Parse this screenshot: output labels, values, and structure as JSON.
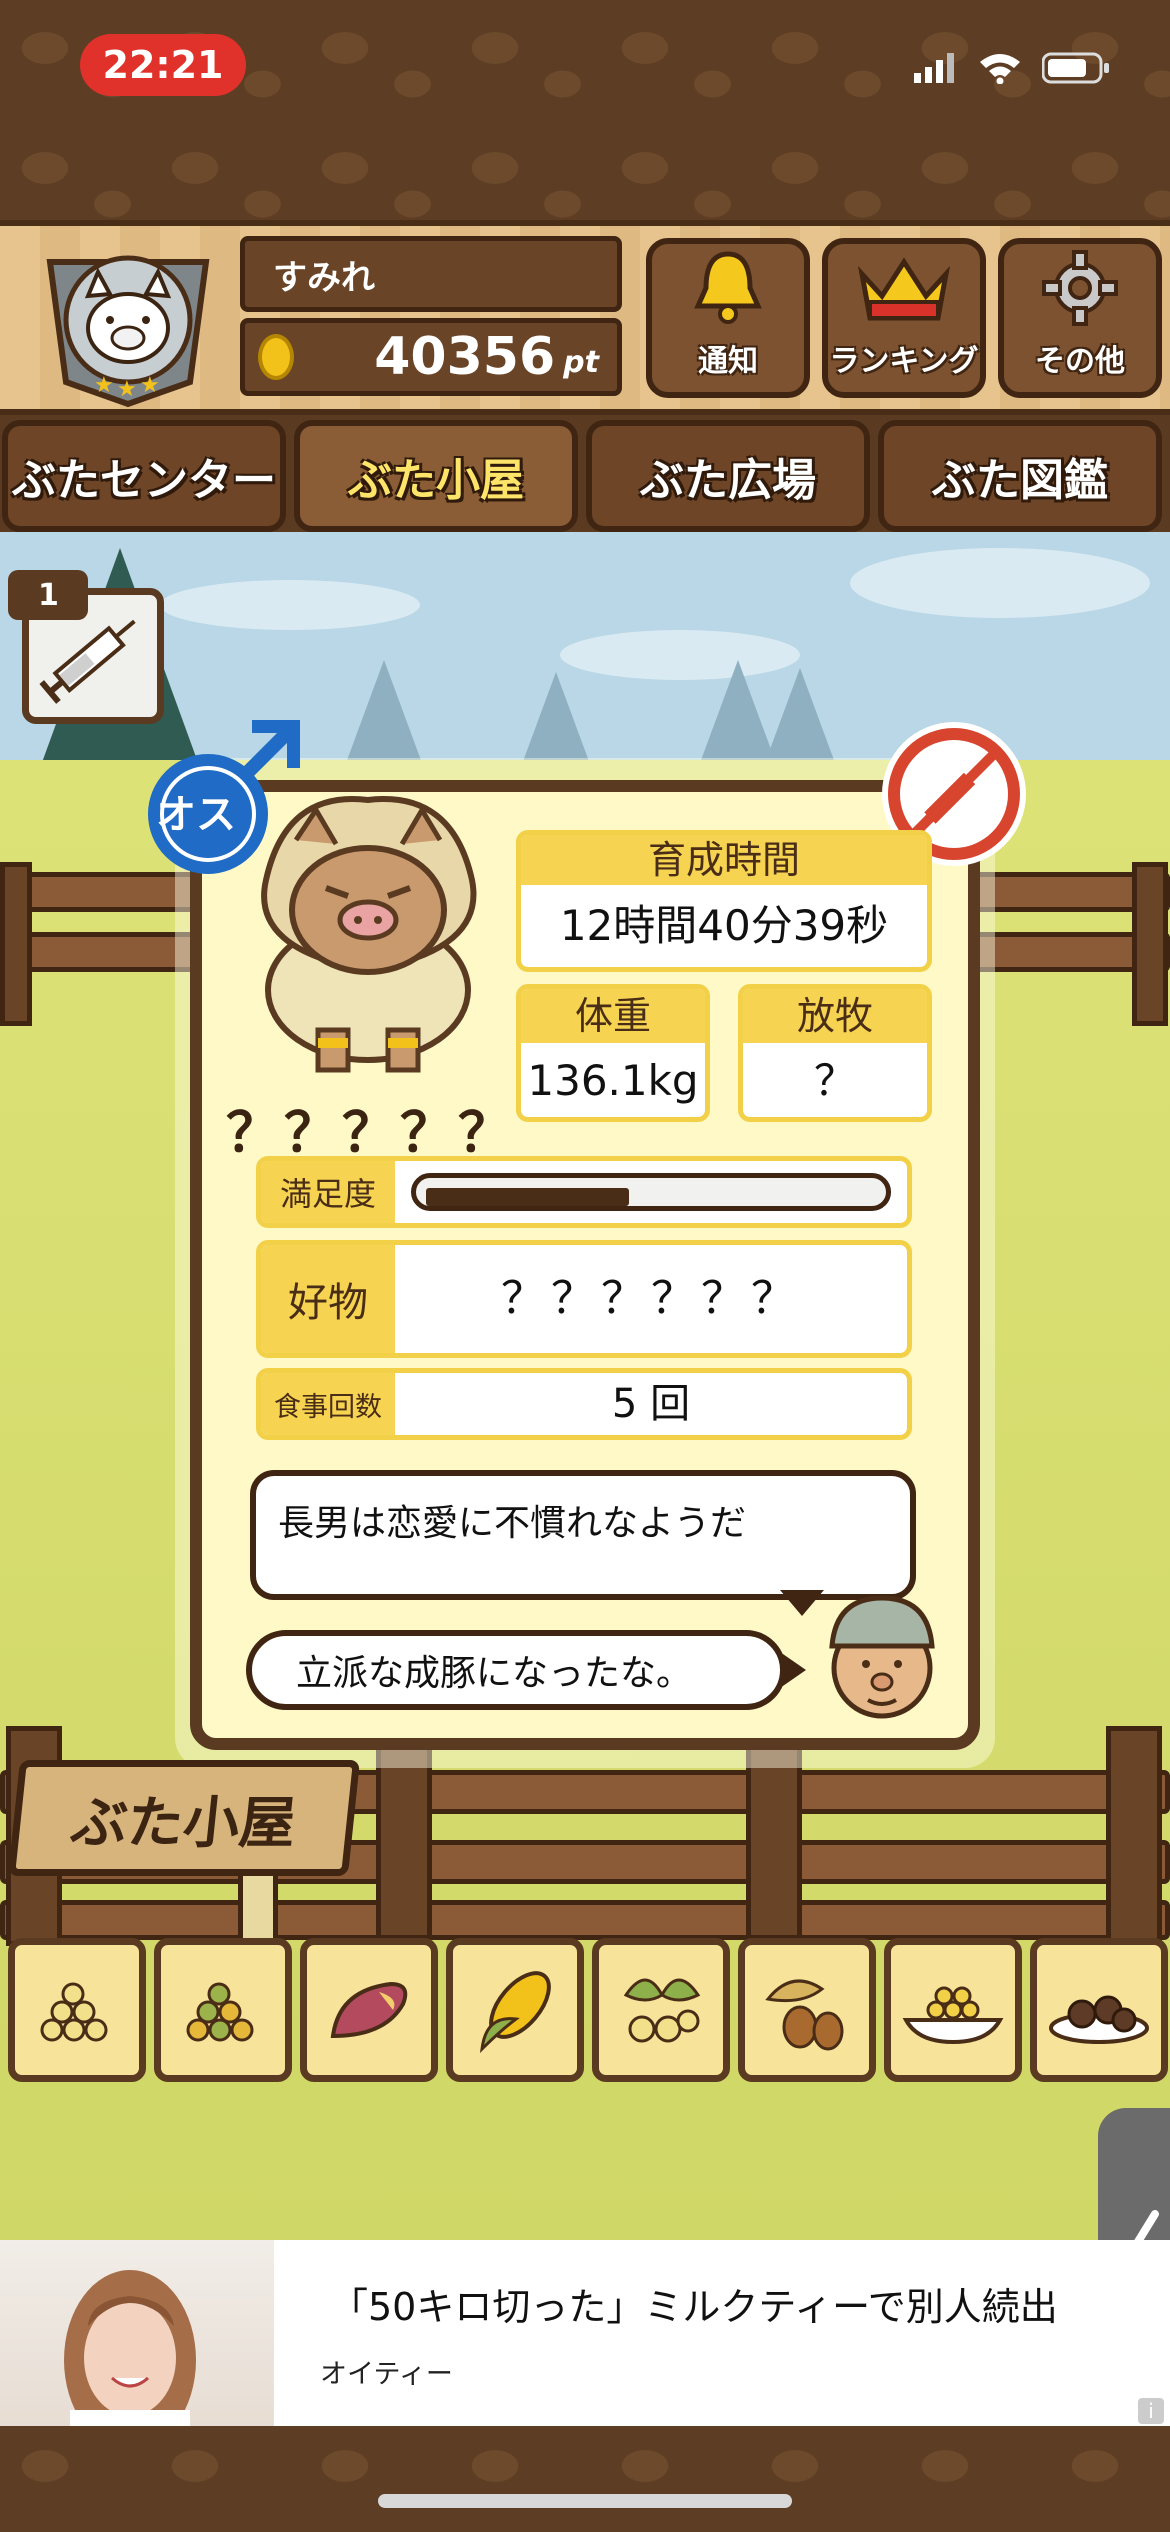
{
  "status_bar": {
    "time": "22:21"
  },
  "header": {
    "player_name": "すみれ",
    "points": "40356",
    "points_unit": "pt",
    "buttons": [
      {
        "label": "通知",
        "icon": "bell-icon"
      },
      {
        "label": "ランキング",
        "icon": "crown-icon"
      },
      {
        "label": "その他",
        "icon": "gear-icon"
      }
    ]
  },
  "tabs": [
    {
      "label": "ぶたセンター",
      "active": false
    },
    {
      "label": "ぶた小屋",
      "active": true
    },
    {
      "label": "ぶた広場",
      "active": false
    },
    {
      "label": "ぶた図鑑",
      "active": false
    }
  ],
  "item": {
    "count": "1",
    "icon": "syringe-icon"
  },
  "pig": {
    "gender": "オス",
    "name": "？？？？？",
    "raising_time_label": "育成時間",
    "raising_time_value": "12時間40分39秒",
    "weight_label": "体重",
    "weight_value": "136.1kg",
    "grazing_label": "放牧",
    "grazing_value": "？",
    "satisfaction_label": "満足度",
    "satisfaction_level": 0.45,
    "favorite_label": "好物",
    "favorite_value": "？？？？？？",
    "meals_label": "食事回数",
    "meals_value": "5 回"
  },
  "dialogue": {
    "message_1": "長男は恋愛に不慣れなようだ",
    "message_2": "立派な成豚になったな。"
  },
  "sign": {
    "label": "ぶた小屋"
  },
  "foods": [
    "soybeans-icon",
    "mixed-beans-icon",
    "sweet-potato-icon",
    "corn-icon",
    "ginkgo-icon",
    "acorn-icon",
    "grain-bowl-icon",
    "chestnut-plate-icon"
  ],
  "ad": {
    "headline": "「50キロ切った」ミルクティーで別人続出",
    "source": "オイティー"
  },
  "colors": {
    "accent": "#f6d451",
    "wood": "#5a3b22",
    "card": "#fff9c8",
    "time_pill": "#e0322b"
  }
}
